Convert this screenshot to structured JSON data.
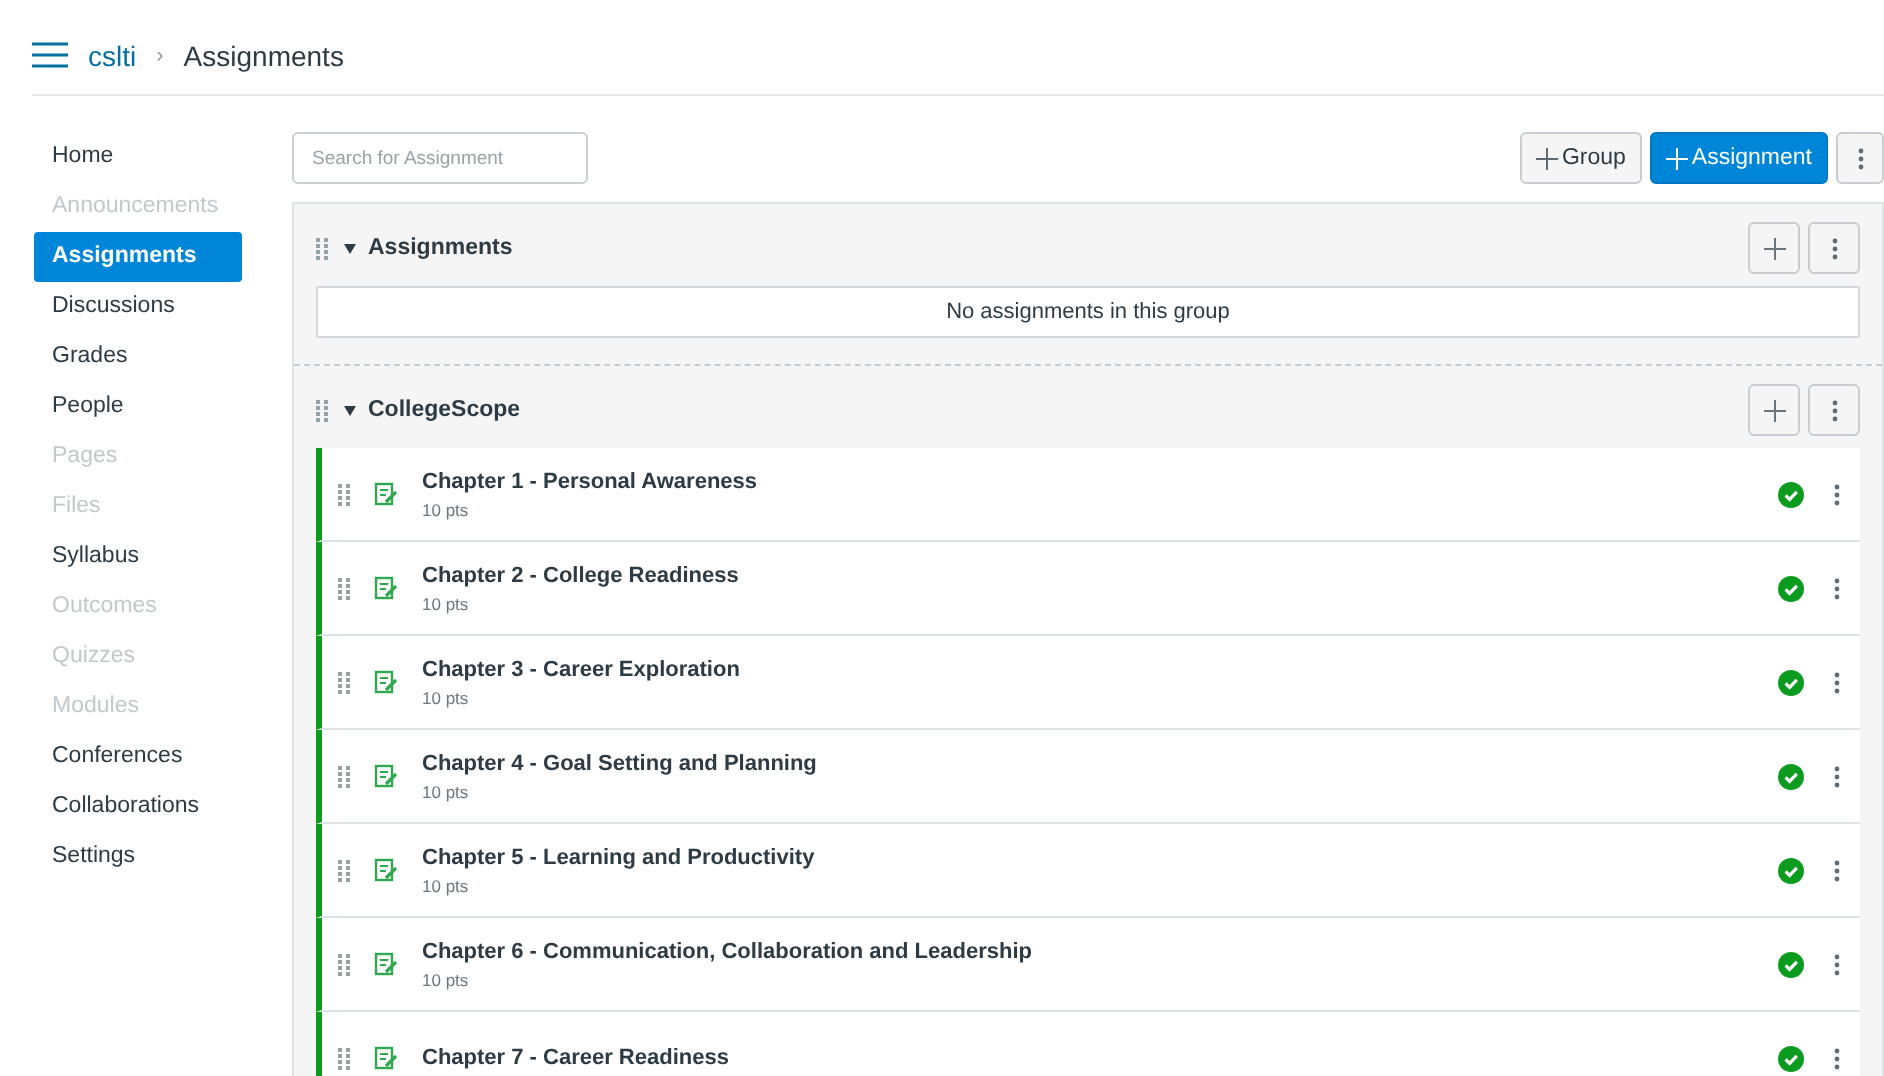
{
  "breadcrumb": [
    {
      "label": "cslti",
      "kind": "link"
    },
    {
      "label": "›",
      "kind": "separator"
    },
    {
      "label": "Assignments",
      "kind": "current"
    }
  ],
  "sidebar": {
    "items": [
      {
        "label": "Home",
        "selected": false,
        "disabled": false
      },
      {
        "label": "Announcements",
        "selected": false,
        "disabled": true
      },
      {
        "label": "Assignments",
        "selected": true,
        "disabled": false
      },
      {
        "label": "Discussions",
        "selected": false,
        "disabled": false
      },
      {
        "label": "Grades",
        "selected": false,
        "disabled": false
      },
      {
        "label": "People",
        "selected": false,
        "disabled": false
      },
      {
        "label": "Pages",
        "selected": false,
        "disabled": true
      },
      {
        "label": "Files",
        "selected": false,
        "disabled": true
      },
      {
        "label": "Syllabus",
        "selected": false,
        "disabled": false
      },
      {
        "label": "Outcomes",
        "selected": false,
        "disabled": true
      },
      {
        "label": "Quizzes",
        "selected": false,
        "disabled": true
      },
      {
        "label": "Modules",
        "selected": false,
        "disabled": true
      },
      {
        "label": "Conferences",
        "selected": false,
        "disabled": false
      },
      {
        "label": "Collaborations",
        "selected": false,
        "disabled": false
      },
      {
        "label": "Settings",
        "selected": false,
        "disabled": false
      }
    ]
  },
  "search": {
    "placeholder": "Search for Assignment"
  },
  "toolbar": {
    "buttons": [
      {
        "label": "Group",
        "kind": "secondary"
      },
      {
        "label": "Assignment",
        "kind": "primary"
      }
    ]
  },
  "groups": [
    {
      "name": "Assignments",
      "empty_text": "No assignments in this group"
    },
    {
      "name": "CollegeScope",
      "assignments": [
        {
          "title": "Chapter 1 - Personal Awareness",
          "points": "10 pts",
          "published": true
        },
        {
          "title": "Chapter 2 - College Readiness",
          "points": "10 pts",
          "published": true
        },
        {
          "title": "Chapter 3 - Career Exploration",
          "points": "10 pts",
          "published": true
        },
        {
          "title": "Chapter 4 - Goal Setting and Planning",
          "points": "10 pts",
          "published": true
        },
        {
          "title": "Chapter 5 - Learning and Productivity",
          "points": "10 pts",
          "published": true
        },
        {
          "title": "Chapter 6 - Communication, Collaboration and Leadership",
          "points": "10 pts",
          "published": true
        },
        {
          "title": "Chapter 7 - Career Readiness",
          "published": true
        }
      ]
    }
  ]
}
